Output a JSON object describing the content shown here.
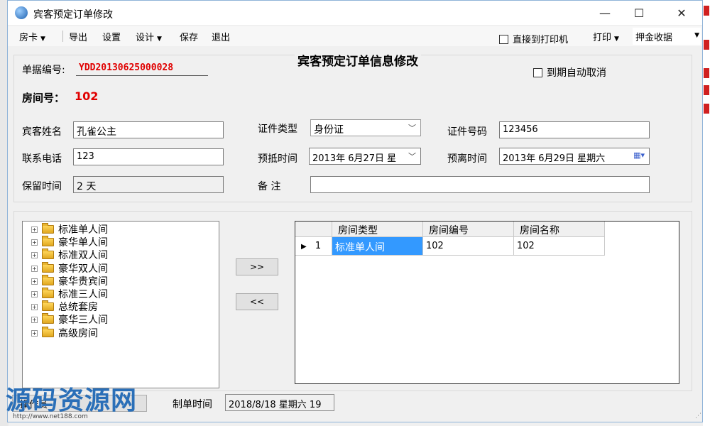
{
  "window": {
    "title": "宾客预定订单修改",
    "minimize": "—",
    "maximize": "☐",
    "close": "✕"
  },
  "toolbar": {
    "room_card": "房卡",
    "export": "导出",
    "settings": "设置",
    "design": "设计",
    "save": "保存",
    "exit": "退出",
    "direct_print": "直接到打印机",
    "print": "打印",
    "deposit_receipt": "押金收据"
  },
  "form": {
    "heading": "宾客预定订单信息修改",
    "order_no_label": "单据编号:",
    "order_no": "YDD20130625000028",
    "auto_cancel_label": "到期自动取消",
    "room_no_label": "房间号：",
    "room_no": "102",
    "guest_name_label": "宾客姓名",
    "guest_name": "孔雀公主",
    "id_type_label": "证件类型",
    "id_type": "身份证",
    "id_no_label": "证件号码",
    "id_no": "123456",
    "phone_label": "联系电话",
    "phone": "123",
    "arrival_label": "预抵时间",
    "arrival": "2013年 6月27日 星",
    "departure_label": "预离时间",
    "departure": "2013年 6月29日 星期六",
    "retain_label": "保留时间",
    "retain": "2  天",
    "remark_label": "备    注",
    "remark": ""
  },
  "room_types": [
    {
      "label": "标准单人间"
    },
    {
      "label": "豪华单人间"
    },
    {
      "label": "标准双人间"
    },
    {
      "label": "豪华双人间"
    },
    {
      "label": "豪华贵宾间"
    },
    {
      "label": "标准三人间"
    },
    {
      "label": "总统套房"
    },
    {
      "label": "豪华三人间"
    },
    {
      "label": "高级房间"
    }
  ],
  "buttons": {
    "add": ">>",
    "remove": "<<"
  },
  "grid": {
    "columns": [
      "房间类型",
      "房间编号",
      "房间名称"
    ],
    "rows": [
      {
        "index": "1",
        "cells": [
          "标准单人间",
          "102",
          "102"
        ]
      }
    ]
  },
  "footer": {
    "operator_label": "操作员",
    "created_label": "制单时间",
    "created_value": "2018/8/18 星期六 19"
  },
  "watermark": {
    "text": "源码资源网",
    "url": "http://www.net188.com"
  },
  "colors": {
    "accent_red": "#e00000",
    "selection_blue": "#3399ff"
  }
}
